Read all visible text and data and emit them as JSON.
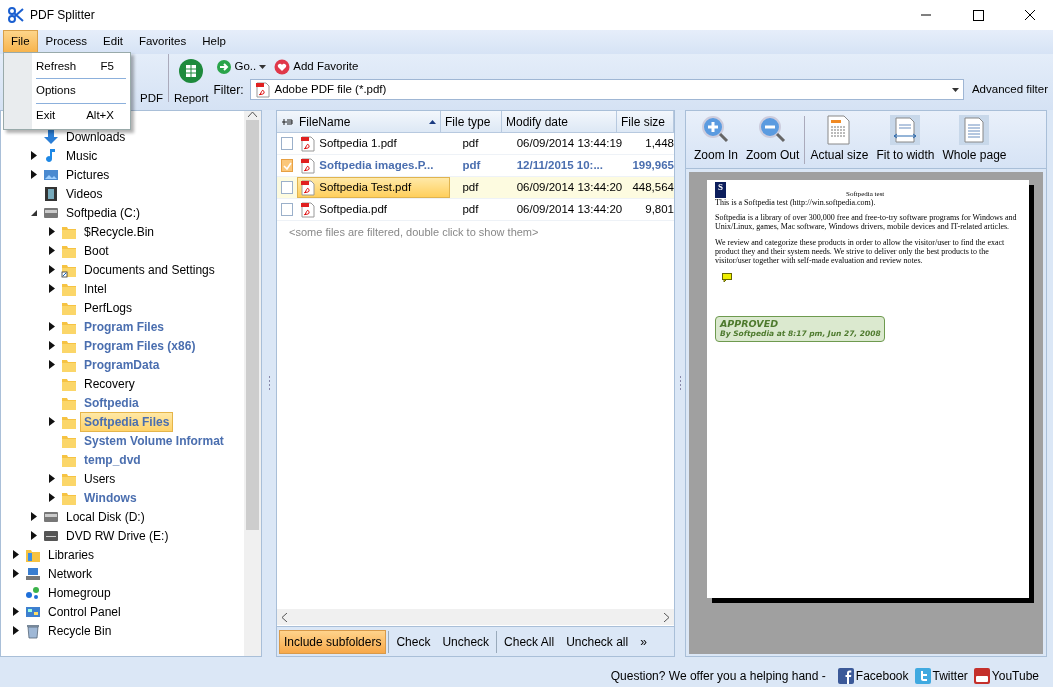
{
  "window": {
    "title": "PDF Splitter"
  },
  "menu": [
    {
      "label": "File",
      "selected": true
    },
    {
      "label": "Process",
      "selected": false
    },
    {
      "label": "Edit",
      "selected": false
    },
    {
      "label": "Favorites",
      "selected": false
    },
    {
      "label": "Help",
      "selected": false
    }
  ],
  "file_menu": [
    {
      "label": "Refresh",
      "shortcut": "F5"
    },
    {
      "label": "Options"
    },
    {
      "label": "Exit",
      "shortcut": "Alt+X"
    }
  ],
  "toolbar": [
    {
      "label": "PDF",
      "kind": "big"
    },
    {
      "label": "Report",
      "kind": "big"
    },
    {
      "label": "Go..",
      "kind": "small",
      "dropdown": true
    },
    {
      "label": "Add Favorite",
      "kind": "small"
    }
  ],
  "filter": {
    "label": "Filter:",
    "value": "Adobe PDF file (*.pdf)",
    "advanced": "Advanced filter"
  },
  "tree": [
    {
      "children": [
        {
          "label": "Downloads",
          "kind": "download",
          "expandable": false
        },
        {
          "label": "Music",
          "kind": "music",
          "expandable": true,
          "expanded": false
        },
        {
          "label": "Pictures",
          "kind": "pictures",
          "expandable": true,
          "expanded": false
        },
        {
          "label": "Videos",
          "kind": "videos",
          "expandable": false
        },
        {
          "label": "Softpedia (C:)",
          "kind": "drive",
          "expandable": true,
          "expanded": true,
          "children": [
            {
              "label": "$Recycle.Bin",
              "kind": "folder",
              "expandable": true,
              "expanded": false,
              "hidden": false,
              "selected": false
            },
            {
              "label": "Boot",
              "kind": "folder",
              "expandable": true,
              "expanded": false,
              "hidden": false,
              "selected": false
            },
            {
              "label": "Documents and Settings",
              "kind": "shortcut",
              "expandable": true,
              "expanded": false,
              "hidden": false,
              "selected": false
            },
            {
              "label": "Intel",
              "kind": "folder",
              "expandable": true,
              "expanded": false,
              "hidden": false,
              "selected": false
            },
            {
              "label": "PerfLogs",
              "kind": "folder",
              "expandable": false,
              "hidden": false,
              "selected": false
            },
            {
              "label": "Program Files",
              "kind": "folder",
              "expandable": true,
              "expanded": false,
              "hidden": true,
              "selected": false
            },
            {
              "label": "Program Files (x86)",
              "kind": "folder",
              "expandable": true,
              "expanded": false,
              "hidden": true,
              "selected": false
            },
            {
              "label": "ProgramData",
              "kind": "folder",
              "expandable": true,
              "expanded": false,
              "hidden": true,
              "selected": false
            },
            {
              "label": "Recovery",
              "kind": "folder",
              "expandable": false,
              "hidden": false,
              "selected": false
            },
            {
              "label": "Softpedia",
              "kind": "folder",
              "expandable": false,
              "hidden": true,
              "selected": false
            },
            {
              "label": "Softpedia Files",
              "kind": "folder",
              "expandable": true,
              "expanded": false,
              "hidden": true,
              "selected": true
            },
            {
              "label": "System Volume Informat",
              "kind": "folder",
              "expandable": false,
              "hidden": true,
              "selected": false
            },
            {
              "label": "temp_dvd",
              "kind": "folder",
              "expandable": false,
              "hidden": true,
              "selected": false
            },
            {
              "label": "Users",
              "kind": "folder",
              "expandable": true,
              "expanded": false,
              "hidden": false,
              "selected": false
            },
            {
              "label": "Windows",
              "kind": "folder",
              "expandable": true,
              "expanded": false,
              "hidden": true,
              "selected": false
            }
          ]
        },
        {
          "label": "Local Disk (D:)",
          "kind": "drive",
          "expandable": true,
          "expanded": false
        },
        {
          "label": "DVD RW Drive (E:)",
          "kind": "dvd",
          "expandable": true,
          "expanded": false
        }
      ]
    },
    {
      "label": "Libraries",
      "kind": "libraries",
      "expandable": true,
      "expanded": false
    },
    {
      "label": "Network",
      "kind": "network",
      "expandable": true,
      "expanded": false
    },
    {
      "label": "Homegroup",
      "kind": "homegroup",
      "expandable": false
    },
    {
      "label": "Control Panel",
      "kind": "control",
      "expandable": true,
      "expanded": false
    },
    {
      "label": "Recycle Bin",
      "kind": "recycle",
      "expandable": true,
      "expanded": false
    }
  ],
  "files": {
    "columns": [
      "FileName",
      "File type",
      "Modify date",
      "File size"
    ],
    "rows": [
      {
        "name": "Softpedia 1.pdf",
        "type": "pdf",
        "date": "06/09/2014 13:44:19",
        "size": "1,448",
        "checked": false,
        "highlighted": false,
        "selected": false
      },
      {
        "name": "Softpedia images.P...",
        "type": "pdf",
        "date": "12/11/2015 10:...",
        "size": "199,965",
        "checked": true,
        "highlighted": true,
        "selected": false
      },
      {
        "name": "Softpedia Test.pdf",
        "type": "pdf",
        "date": "06/09/2014 13:44:20",
        "size": "448,564",
        "checked": false,
        "highlighted": false,
        "selected": true
      },
      {
        "name": "Softpedia.pdf",
        "type": "pdf",
        "date": "06/09/2014 13:44:20",
        "size": "9,801",
        "checked": false,
        "highlighted": false,
        "selected": false
      }
    ],
    "note": "<some files are filtered, double click to show them>"
  },
  "list_toolbar": [
    {
      "label": "Include subfolders",
      "on": true
    },
    {
      "label": "Check"
    },
    {
      "label": "Uncheck"
    },
    {
      "label": "Check All"
    },
    {
      "label": "Uncheck all"
    },
    {
      "label": "»"
    }
  ],
  "preview_toolbar": [
    {
      "label": "Zoom In"
    },
    {
      "label": "Zoom Out"
    },
    {
      "label": "Actual size"
    },
    {
      "label": "Fit to width"
    },
    {
      "label": "Whole page"
    }
  ],
  "document": {
    "logo": "S",
    "header": "Softpedia test",
    "paragraphs": [
      "This is a Softpedia test (http://win.softpedia.com).",
      "Softpedia is a library of over 300,000 free and free-to-try software programs for Windows and Unix/Linux, games, Mac software, Windows drivers, mobile devices and IT-related articles.",
      "We review and categorize these products in order to allow the visitor/user to find the exact product they and their system needs. We strive to deliver only the best products to the visitor/user together with self-made evaluation and review notes."
    ],
    "stamp_title": "APPROVED",
    "stamp_text": "By Softpedia at 8:17 pm, Jun 27, 2008"
  },
  "status_bar": {
    "text": "Question? We offer you a helping hand -",
    "links": [
      {
        "label": "Facebook"
      },
      {
        "label": "Twitter"
      },
      {
        "label": "YouTube"
      }
    ]
  }
}
